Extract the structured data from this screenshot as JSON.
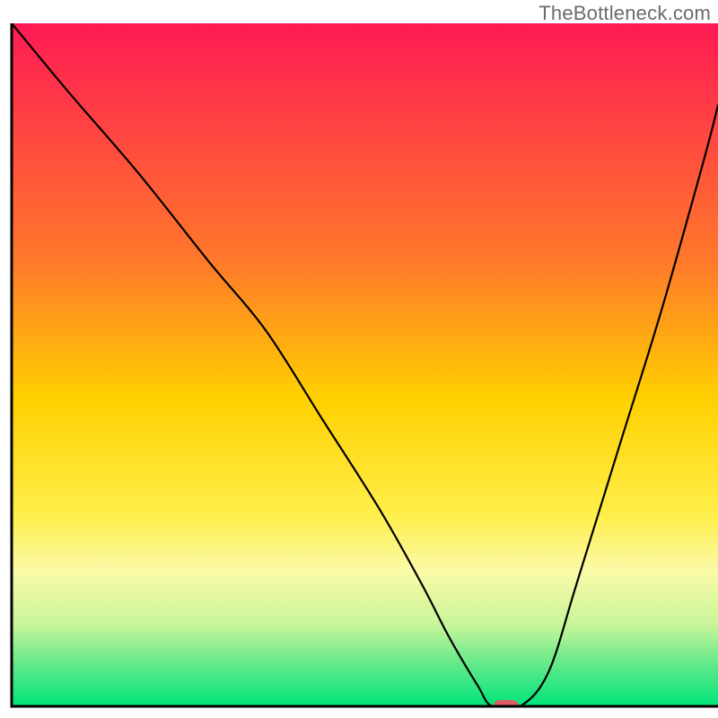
{
  "watermark": "TheBottleneck.com",
  "chart_data": {
    "type": "line",
    "title": "",
    "xlabel": "",
    "ylabel": "",
    "xlim": [
      0,
      100
    ],
    "ylim": [
      0,
      100
    ],
    "grid": false,
    "legend": false,
    "gradient_stops": [
      {
        "offset": 0,
        "color": "#ff1a54"
      },
      {
        "offset": 35,
        "color": "#ff7a2a"
      },
      {
        "offset": 55,
        "color": "#ffd000"
      },
      {
        "offset": 72,
        "color": "#ffef4a"
      },
      {
        "offset": 80,
        "color": "#fbfaa7"
      },
      {
        "offset": 88,
        "color": "#c9f59a"
      },
      {
        "offset": 94,
        "color": "#5fe98a"
      },
      {
        "offset": 100,
        "color": "#00e47a"
      }
    ],
    "series": [
      {
        "name": "bottleneck-curve",
        "x": [
          0,
          8,
          18,
          28,
          36,
          44,
          52,
          58,
          62,
          66,
          68,
          72,
          76,
          80,
          86,
          92,
          98,
          100
        ],
        "y": [
          100,
          90,
          78,
          65,
          55,
          42,
          29,
          18,
          10,
          3,
          0,
          0,
          5,
          18,
          38,
          58,
          80,
          88
        ]
      }
    ],
    "marker": {
      "name": "optimal-point",
      "x": 70,
      "y": 0,
      "color": "#e05a63",
      "shape": "pill"
    },
    "axes": {
      "frame_color": "#000000",
      "frame_width": 3
    }
  }
}
